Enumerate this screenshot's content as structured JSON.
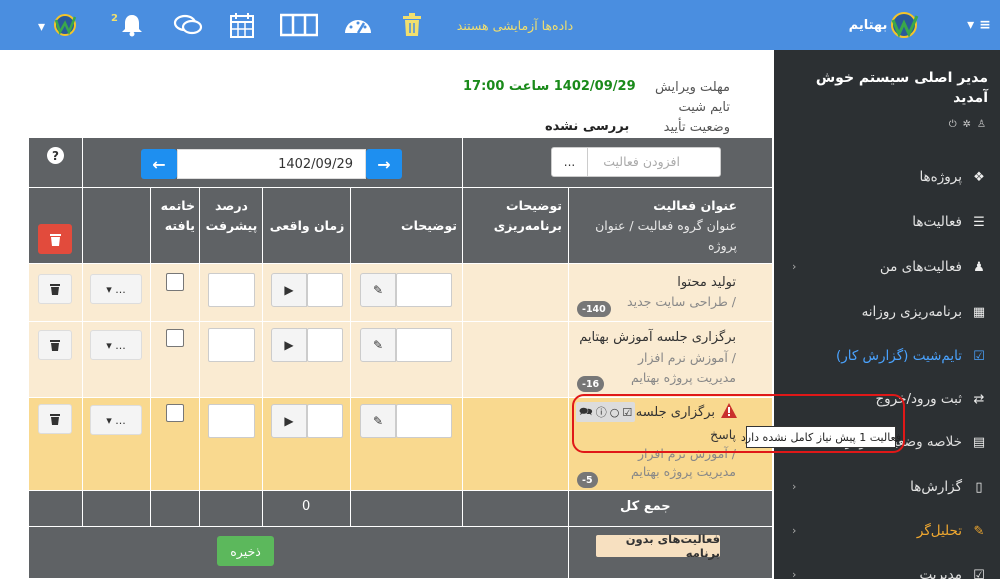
{
  "topbar": {
    "brand": "بهتایم",
    "demo_notice": "داده‌ها آزمایشی هستند",
    "notification_count": "2",
    "icons": [
      "hamburger-menu-icon",
      "logo-icon",
      "bell-icon",
      "chat-icon",
      "calendar-icon",
      "columns-icon",
      "gauge-icon",
      "trash-icon"
    ]
  },
  "sidebar": {
    "welcome": "مدیر اصلی سیستم خوش آمدید",
    "items": [
      {
        "label": "پروژه‌ها",
        "icon": "cubes-icon"
      },
      {
        "label": "فعالیت‌ها",
        "icon": "list-icon"
      },
      {
        "label": "فعالیت‌های من",
        "icon": "user-icon"
      },
      {
        "label": "برنامه‌ریزی روزانه",
        "icon": "table-icon"
      },
      {
        "label": "تایم‌شیت (گزارش کار)",
        "icon": "calendar-check-icon"
      },
      {
        "label": "ثبت ورود/خروج",
        "icon": "exchange-icon"
      },
      {
        "label": "خلاصه وضعیت کارکرد",
        "icon": "summary-icon"
      },
      {
        "label": "گزارش‌ها",
        "icon": "file-icon"
      },
      {
        "label": "تحلیل‌گر",
        "icon": "magic-icon"
      },
      {
        "label": "مدیریت",
        "icon": "check-square-icon"
      }
    ]
  },
  "info": {
    "deadline_label": "مهلت ویرایش",
    "deadline_value": "1402/09/29 ساعت 17:00",
    "timesheet_label": "تایم شیت",
    "status_label": "وضعیت تأیید",
    "status_value": "بررسی نشده"
  },
  "toolbar": {
    "date": "1402/09/29",
    "prev": "←",
    "next": "→",
    "add_activity_placeholder": "افزودن فعالیت",
    "add_activity_dots": "...",
    "help": "?"
  },
  "table": {
    "headers": {
      "title": "عنوان فعالیت",
      "title_sub": "عنوان گروه فعالیت / عنوان پروژه",
      "plan_desc": "توضیحات برنامه‌ریزی",
      "desc": "توضیحات",
      "actual_time": "زمان واقعی",
      "progress": "درصد پیشرفت",
      "done": "خاتمه یافته"
    },
    "rows": [
      {
        "title": "تولید محتوا",
        "sub1": "/ طراحی سایت جدید",
        "sub2": "",
        "sub3": "",
        "badge": "-140",
        "dropdown": "..."
      },
      {
        "title": "برگزاری جلسه آموزش بهتایم",
        "sub1": "/ آموزش نرم افزار",
        "sub2": "مدیریت پروژه بهتایم",
        "sub3": "",
        "badge": "-16",
        "dropdown": "..."
      },
      {
        "title": "برگزاری جلسه",
        "sub1": "پاسخ",
        "sub2": "/ آموزش نرم افزار",
        "sub3": "مدیریت پروژه بهتایم",
        "badge": "-5",
        "dropdown": "..."
      }
    ],
    "total_label": "جمع کل",
    "total_value": "0",
    "save_label": "ذخیره",
    "no_program_label": "فعالیت‌های بدون برنامه"
  },
  "tooltip": "فعالیت 1 پیش نیاز کامل نشده دارد",
  "colors": {
    "topbar": "#4a8ee0",
    "sidebar": "#2c3033",
    "header": "#5f6265",
    "row_light": "#faebd2",
    "row_highlight": "#f9d98f",
    "accent": "#1e8ff0",
    "danger": "#e24b3c",
    "success": "#5cb85c"
  }
}
